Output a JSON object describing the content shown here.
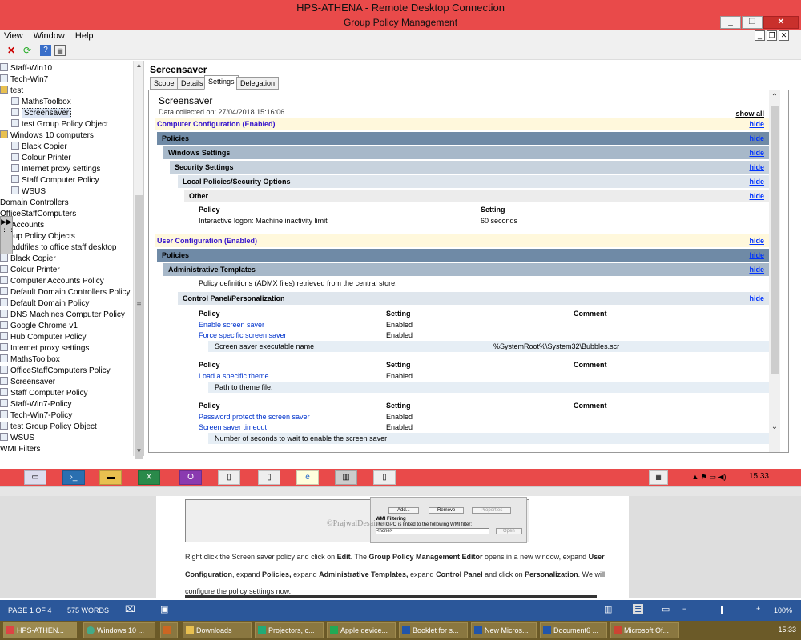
{
  "rdp_window": {
    "title": "HPS-ATHENA - Remote Desktop Connection"
  },
  "app": {
    "title": "Group Policy Management"
  },
  "menu": [
    "View",
    "Window",
    "Help"
  ],
  "tree": [
    "Staff-Win10",
    "Tech-Win7",
    "test",
    "MathsToolbox",
    "Screensaver",
    "test Group Policy Object",
    "Windows 10 computers",
    "Black Copier",
    "Colour Printer",
    "Internet proxy settings",
    "Staff Computer Policy",
    "WSUS",
    "Domain Controllers",
    "OfficeStaffComputers",
    "Accounts",
    "Group Policy Objects",
    "addfiles to office staff desktop",
    "Black Copier",
    "Colour Printer",
    "Computer Accounts Policy",
    "Default Domain Controllers Policy",
    "Default Domain Policy",
    "DNS Machines Computer Policy",
    "Google Chrome v1",
    "Hub Computer Policy",
    "Internet proxy settings",
    "MathsToolbox",
    "OfficeStaffComputers  Policy",
    "Screensaver",
    "Staff Computer Policy",
    "Staff-Win7-Policy",
    "Tech-Win7-Policy",
    "test Group Policy Object",
    "WSUS",
    "WMI Filters"
  ],
  "gpo": {
    "name": "Screensaver",
    "tabs": [
      "Scope",
      "Details",
      "Settings",
      "Delegation"
    ],
    "active_tab": "Settings"
  },
  "report": {
    "title": "Screensaver",
    "collected": "Data collected on: 27/04/2018 15:16:06",
    "show_all": "show all",
    "hide": "hide",
    "computer_config": "Computer Configuration (Enabled)",
    "policies": "Policies",
    "windows_settings": "Windows Settings",
    "security_settings": "Security Settings",
    "local_policies": "Local Policies/Security Options",
    "other": "Other",
    "col_policy": "Policy",
    "col_setting": "Setting",
    "col_comment": "Comment",
    "cc_row": {
      "policy": "Interactive logon: Machine inactivity limit",
      "setting": "60 seconds"
    },
    "user_config": "User Configuration (Enabled)",
    "admin_templates": "Administrative Templates",
    "admx_note": "Policy definitions (ADMX files) retrieved from the central store.",
    "control_panel": "Control Panel/Personalization",
    "group1": [
      {
        "policy": "Enable screen saver",
        "setting": "Enabled"
      },
      {
        "policy": "Force specific screen saver",
        "setting": "Enabled"
      }
    ],
    "exe_label": "Screen saver executable name",
    "exe_value": "%SystemRoot%\\System32\\Bubbles.scr",
    "group2": [
      {
        "policy": "Load a specific theme",
        "setting": "Enabled"
      }
    ],
    "theme_label": "Path to theme file:",
    "group3": [
      {
        "policy": "Password protect the screen saver",
        "setting": "Enabled"
      },
      {
        "policy": "Screen saver timeout",
        "setting": "Enabled"
      }
    ],
    "timeout_label": "Number of seconds to wait to enable the screen saver"
  },
  "rdp_clock": "15:33",
  "doc": {
    "watermark": "©PrajwalDesai.com",
    "dlg_buttons": [
      "Add...",
      "Remove",
      "Properties"
    ],
    "dlg_wmi": "WMI Filtering",
    "dlg_wmi_text": "This GPO is linked to the following WMI filter:",
    "dlg_none": "<none>",
    "dlg_open": "Open",
    "p1": "Right click the Screen saver policy and click on",
    "edit": "Edit",
    "p2": ". The",
    "editor": "Group Policy Management Editor",
    "p3": "opens in a new window, expand",
    "user": "User",
    "configuration": "Configuration",
    "p4": ", expand",
    "policies": "Policies,",
    "p5": "expand",
    "admin": "Administrative Templates,",
    "p6": "expand",
    "cp": "Control Panel",
    "p7": "and click on",
    "pers": "Personalization",
    "p8": ". We will",
    "p9": "configure the policy settings now.",
    "embed_title": "Group Policy Management Editor"
  },
  "word_status": {
    "page": "PAGE 1 OF 4",
    "words": "575 WORDS",
    "zoom": "100%"
  },
  "taskbar": [
    {
      "label": "HPS-ATHEN...",
      "color": "#d44"
    },
    {
      "label": "Windows 10 ...",
      "color": "#4a8"
    },
    {
      "label": "",
      "color": "#c62"
    },
    {
      "label": "Downloads",
      "color": "#e8c050"
    },
    {
      "label": "Projectors, c...",
      "color": "#2a7"
    },
    {
      "label": "Apple device...",
      "color": "#2a5"
    },
    {
      "label": "Booklet for s...",
      "color": "#25a"
    },
    {
      "label": "New Micros...",
      "color": "#25a"
    },
    {
      "label": "Document6 ...",
      "color": "#25a"
    },
    {
      "label": "Microsoft Of...",
      "color": "#c43"
    }
  ],
  "clock": "15:33"
}
